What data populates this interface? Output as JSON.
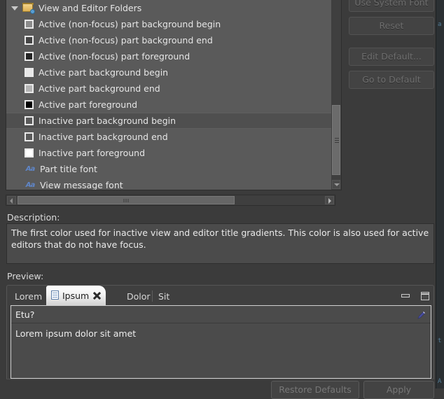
{
  "tree": {
    "root": {
      "label": "View and Editor Folders",
      "icon": "folder-icon",
      "twisty": "chevron-down-icon",
      "expanded": true
    },
    "items": [
      {
        "label": "Active (non-focus) part background begin",
        "type": "color",
        "swatch": "#8c8c8c",
        "selected": false
      },
      {
        "label": "Active (non-focus) part background end",
        "type": "color",
        "swatch": "#454545",
        "selected": false
      },
      {
        "label": "Active (non-focus) part foreground",
        "type": "color",
        "swatch": "#242424",
        "selected": false
      },
      {
        "label": "Active part background begin",
        "type": "color",
        "swatch": "#e8e8e8",
        "selected": false
      },
      {
        "label": "Active part background end",
        "type": "color",
        "swatch": "#b4b4b4",
        "selected": false
      },
      {
        "label": "Active part foreground",
        "type": "color",
        "swatch": "#000000",
        "selected": false
      },
      {
        "label": "Inactive part background begin",
        "type": "color",
        "swatch": "#5a5a5a",
        "selected": true
      },
      {
        "label": "Inactive part background end",
        "type": "color",
        "swatch": "#5a5a5a",
        "selected": false
      },
      {
        "label": "Inactive part foreground",
        "type": "color",
        "swatch": "#ffffff",
        "selected": false
      },
      {
        "label": "Part title font",
        "type": "font",
        "swatch": "",
        "selected": false
      },
      {
        "label": "View message font",
        "type": "font",
        "swatch": "",
        "selected": false
      }
    ]
  },
  "side_buttons": [
    {
      "label": "Use System Font",
      "mnemonic": "U",
      "enabled": false
    },
    {
      "label": "Reset",
      "mnemonic": "R",
      "enabled": false
    },
    {
      "label": "Edit Default...",
      "mnemonic": "i",
      "enabled": false
    },
    {
      "label": "Go to Default",
      "mnemonic": "G",
      "enabled": false
    }
  ],
  "description": {
    "label": "Description:",
    "text": "The first color used for inactive view and editor title gradients.  This color is also used for active editors that do not have focus."
  },
  "preview": {
    "label": "Preview:",
    "tabs": [
      {
        "label": "Lorem",
        "active": false,
        "icon": null,
        "closable": false
      },
      {
        "label": "Ipsum",
        "active": true,
        "icon": "document-icon",
        "closable": true
      },
      {
        "label": "Dolor",
        "active": false,
        "icon": null,
        "closable": false
      },
      {
        "label": "Sit",
        "active": false,
        "icon": null,
        "closable": false
      }
    ],
    "window_buttons": [
      {
        "name": "minimize-button",
        "icon": "minimize-icon"
      },
      {
        "name": "maximize-button",
        "icon": "maximize-icon"
      }
    ],
    "header_text": "Etu?",
    "header_icon": "edit-pencil-icon",
    "body_text": "Lorem ipsum dolor sit amet"
  },
  "bottom_buttons": [
    {
      "label": "Restore Defaults",
      "enabled": false
    },
    {
      "label": "Apply",
      "enabled": false
    }
  ],
  "background_window": {
    "fragments": [
      "a",
      "t",
      "A"
    ]
  },
  "scrollbars": {
    "tree_vertical": {
      "thumb_top_pct": 55,
      "thumb_size_pct": 37
    },
    "tree_horizontal": {
      "thumb_left_pct": 3,
      "thumb_size_pct": 67
    }
  },
  "colors": {
    "panel_bg": "#3b3b3b",
    "tree_bg": "#5a5a5a",
    "field_bg": "#4b4b4b",
    "selection_bg": "#4f4f4f",
    "text": "#e6e6e6",
    "disabled_text": "#6e6e6e",
    "accent_blue": "#5f86c9"
  }
}
